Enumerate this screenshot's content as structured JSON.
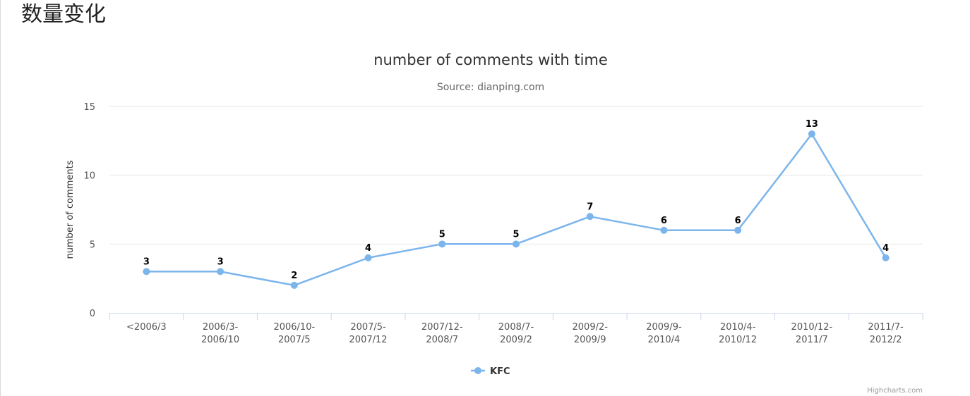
{
  "page": {
    "heading": "数量变化"
  },
  "chart_data": {
    "type": "line",
    "title": "number of comments with time",
    "subtitle": "Source: dianping.com",
    "xlabel": "",
    "ylabel": "number of comments",
    "ylim": [
      0,
      15
    ],
    "yticks": [
      0,
      5,
      10,
      15
    ],
    "grid": true,
    "legend_position": "bottom-center",
    "categories": [
      [
        "<2006/3"
      ],
      [
        "2006/3-",
        "2006/10"
      ],
      [
        "2006/10-",
        "2007/5"
      ],
      [
        "2007/5-",
        "2007/12"
      ],
      [
        "2007/12-",
        "2008/7"
      ],
      [
        "2008/7-",
        "2009/2"
      ],
      [
        "2009/2-",
        "2009/9"
      ],
      [
        "2009/9-",
        "2010/4"
      ],
      [
        "2010/4-",
        "2010/12"
      ],
      [
        "2010/12-",
        "2011/7"
      ],
      [
        "2011/7-",
        "2012/2"
      ]
    ],
    "series": [
      {
        "name": "KFC",
        "color": "#7cb5ec",
        "values": [
          3,
          3,
          2,
          4,
          5,
          5,
          7,
          6,
          6,
          13,
          4
        ]
      }
    ],
    "credits": "Highcharts.com",
    "gridline_color": "#e6e6e6",
    "axis_line_color": "#ccd6eb"
  }
}
